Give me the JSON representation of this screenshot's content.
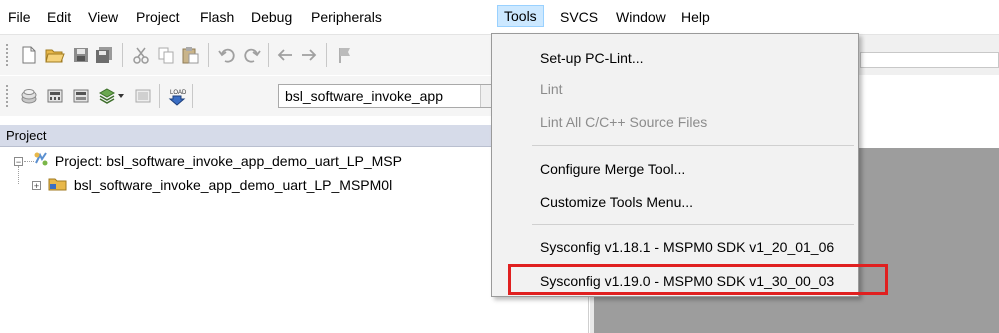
{
  "menubar": {
    "items": [
      "File",
      "Edit",
      "View",
      "Project",
      "Flash",
      "Debug",
      "Peripherals",
      "Tools",
      "SVCS",
      "Window",
      "Help"
    ],
    "active": "Tools"
  },
  "toolbar2": {
    "target_combo": "bsl_software_invoke_app"
  },
  "project_panel": {
    "title": "Project",
    "tree": [
      "Project: bsl_software_invoke_app_demo_uart_LP_MSP",
      "bsl_software_invoke_app_demo_uart_LP_MSPM0l"
    ]
  },
  "tools_menu": {
    "items": [
      {
        "label": "Set-up PC-Lint...",
        "enabled": true
      },
      {
        "label": "Lint",
        "enabled": false
      },
      {
        "label": "Lint All C/C++ Source Files",
        "enabled": false
      },
      {
        "label": "Configure Merge Tool...",
        "enabled": true
      },
      {
        "label": "Customize Tools Menu...",
        "enabled": true
      },
      {
        "label": "Sysconfig v1.18.1 - MSPM0 SDK v1_20_01_06",
        "enabled": true
      },
      {
        "label": "Sysconfig v1.19.0 - MSPM0 SDK v1_30_00_03",
        "enabled": true,
        "highlighted": true
      }
    ]
  },
  "colors": {
    "highlight_border": "#e02020",
    "menu_active_bg": "#cce8ff",
    "panel_header_bg": "#d6dbe9"
  }
}
